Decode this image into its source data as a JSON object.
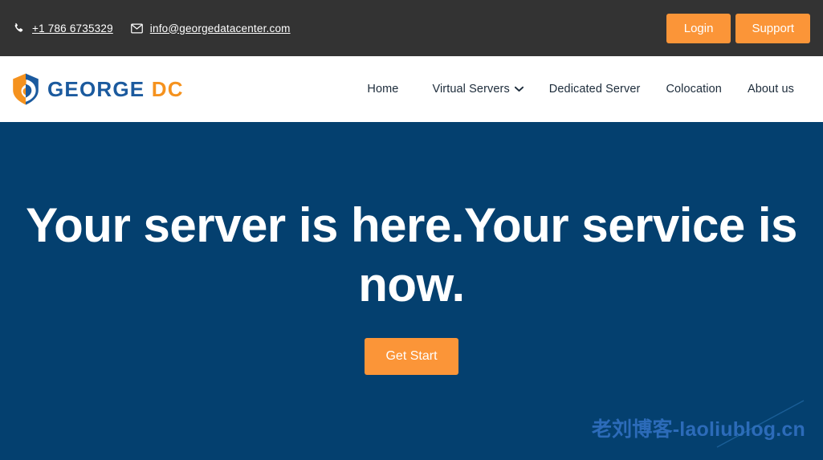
{
  "colors": {
    "topbar_bg": "#333333",
    "header_bg": "#ffffff",
    "hero_bg": "#04406f",
    "accent_orange": "#fb9538",
    "brand_blue": "#1b5a9e",
    "brand_orange": "#f5921e",
    "watermark_blue": "#2f6ebd"
  },
  "topbar": {
    "phone_icon": "phone-icon",
    "phone": "+1 786 6735329",
    "email_icon": "envelope-icon",
    "email": "info@georgedatacenter.com",
    "login_label": "Login",
    "support_label": "Support"
  },
  "header": {
    "logo_icon": "george-dc-shield-logo",
    "brand_primary": "GEORGE",
    "brand_secondary": "DC",
    "nav": [
      {
        "label": "Home",
        "has_caret": false
      },
      {
        "label": "Virtual Servers",
        "has_caret": true,
        "caret_icon": "chevron-down-icon"
      },
      {
        "label": "Dedicated Server",
        "has_caret": false
      },
      {
        "label": "Colocation",
        "has_caret": false
      },
      {
        "label": "About us",
        "has_caret": false
      }
    ]
  },
  "hero": {
    "title": "Your server is here.Your service is now.",
    "cta_label": "Get Start"
  },
  "watermark": {
    "text": "老刘博客-laoliublog.cn"
  }
}
